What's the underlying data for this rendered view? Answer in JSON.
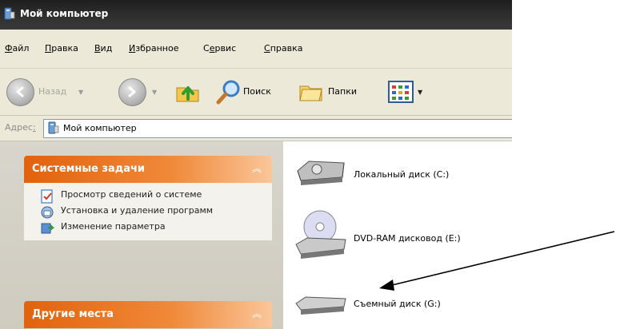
{
  "window": {
    "title": "Мой компьютер"
  },
  "menu": {
    "items": [
      {
        "key": "Ф",
        "rest": "айл"
      },
      {
        "key": "П",
        "rest": "равка"
      },
      {
        "key": "В",
        "rest": "ид"
      },
      {
        "key": "И",
        "rest": "збранное"
      },
      {
        "pre": "С",
        "key": "е",
        "rest": "рвис"
      },
      {
        "key": "С",
        "rest": "правка"
      }
    ]
  },
  "toolbar": {
    "back_label": "Назад",
    "search_label": "Поиск",
    "folders_label": "Папки"
  },
  "address": {
    "label_pre": "Адрес",
    "label_key": ":",
    "value": "Мой компьютер"
  },
  "taskpane": {
    "system_tasks": {
      "title": "Системные задачи",
      "items": [
        {
          "label": "Просмотр сведений о системе",
          "icon": "system-info-icon"
        },
        {
          "label": "Установка и удаление программ",
          "icon": "add-remove-programs-icon"
        },
        {
          "label": "Изменение параметра",
          "icon": "change-setting-icon"
        }
      ]
    },
    "other_places": {
      "title": "Другие места"
    }
  },
  "drives": [
    {
      "label": "Локальный диск (C:)",
      "icon": "hard-disk-icon"
    },
    {
      "label": "DVD-RAM дисковод (E:)",
      "icon": "dvd-drive-icon"
    },
    {
      "label": "Съемный диск (G:)",
      "icon": "removable-disk-icon"
    }
  ],
  "colors": {
    "accent": "#e2620d",
    "title_bar": "#2b2b2b",
    "chrome": "#ece9d8"
  }
}
